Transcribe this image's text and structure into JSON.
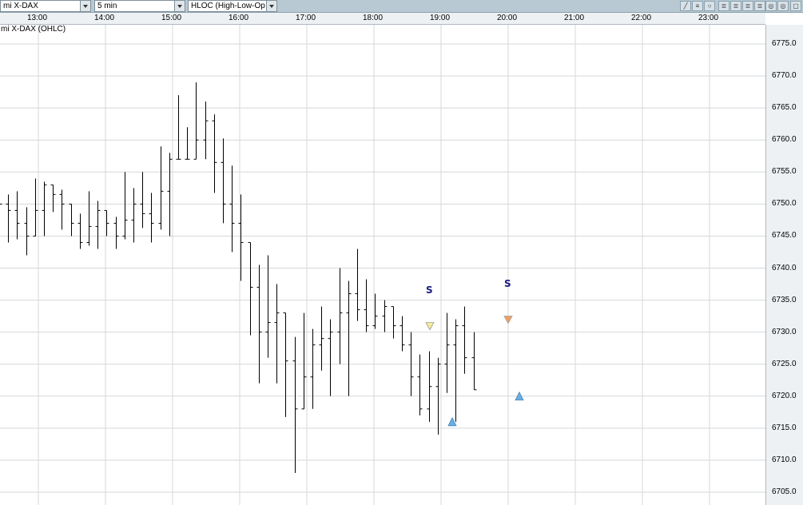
{
  "toolbar": {
    "instrument_select": "mi X-DAX",
    "interval_select": "5 min",
    "chart_type_select": "HLOC (High-Low-Open-Close)"
  },
  "instrument_label": "mi X-DAX (OHLC)",
  "time_labels": [
    "13:00",
    "14:00",
    "15:00",
    "16:00",
    "17:00",
    "18:00",
    "19:00",
    "20:00",
    "21:00",
    "22:00",
    "23:00"
  ],
  "price_labels": [
    "6775.0",
    "6770.0",
    "6765.0",
    "6760.0",
    "6755.0",
    "6750.0",
    "6745.0",
    "6740.0",
    "6735.0",
    "6730.0",
    "6725.0",
    "6720.0",
    "6715.0",
    "6710.0",
    "6705.0"
  ],
  "signals": [
    "S",
    "S"
  ],
  "colors": {
    "toolbar": "#b9c9d3",
    "grid": "#d5d8da",
    "bars": "#000000",
    "signal_text": "#1a1a80",
    "arrow_up": "#6aaee0",
    "arrow_down_yellow": "#f6ec9a",
    "arrow_down_orange": "#f0a060"
  },
  "chart_data": {
    "type": "bar",
    "title": "mi X-DAX (OHLC)",
    "interval": "5 min",
    "x_labels": [
      "13:00",
      "14:00",
      "15:00",
      "16:00",
      "17:00",
      "18:00",
      "19:00",
      "20:00",
      "21:00",
      "22:00",
      "23:00"
    ],
    "ylim": [
      6703,
      6778
    ],
    "y_ticks": [
      6705,
      6710,
      6715,
      6720,
      6725,
      6730,
      6735,
      6740,
      6745,
      6750,
      6755,
      6760,
      6765,
      6770,
      6775
    ],
    "bars_start_time": "12:25",
    "bars": [
      [
        6751,
        6753,
        6744,
        6749
      ],
      [
        6749,
        6752,
        6742,
        6745
      ],
      [
        6745,
        6754,
        6745,
        6753
      ],
      [
        6753,
        6753,
        6746,
        6750
      ],
      [
        6750,
        6750,
        6743,
        6744
      ],
      [
        6744,
        6752,
        6743,
        6749
      ],
      [
        6749,
        6749,
        6743,
        6745
      ],
      [
        6745,
        6755,
        6744,
        6750
      ],
      [
        6750,
        6755,
        6744,
        6747
      ],
      [
        6747,
        6759,
        6745,
        6757
      ],
      [
        6757,
        6767,
        6757,
        6757
      ],
      [
        6757,
        6769,
        6757,
        6763
      ],
      [
        6763,
        6764,
        6747,
        6750
      ],
      [
        6750,
        6756,
        6738,
        6744
      ],
      [
        6744,
        6744,
        6722,
        6730
      ],
      [
        6730,
        6742,
        6722,
        6733
      ],
      [
        6733,
        6733,
        6708,
        6718
      ],
      [
        6718,
        6733,
        6718,
        6728
      ],
      [
        6728,
        6734,
        6720,
        6730
      ],
      [
        6730,
        6740,
        6720,
        6736
      ],
      [
        6736,
        6743,
        6730,
        6731
      ],
      [
        6731,
        6736,
        6730,
        6734
      ],
      [
        6734,
        6734,
        6727,
        6728
      ],
      [
        6728,
        6730,
        6717,
        6718
      ],
      [
        6718,
        6727,
        6714,
        6725
      ],
      [
        6725,
        6733,
        6716,
        6731
      ],
      [
        6731,
        6734,
        6721,
        6721
      ]
    ],
    "signals": [
      {
        "label": "S",
        "x_time": "18:50",
        "price": 6731,
        "marker": "down-yellow"
      },
      {
        "label": "S",
        "x_time": "20:00",
        "price": 6732,
        "marker": "down-orange"
      }
    ],
    "arrows_up": [
      {
        "x_time": "19:10",
        "price": 6716
      },
      {
        "x_time": "20:10",
        "price": 6720
      }
    ],
    "grid": true
  }
}
